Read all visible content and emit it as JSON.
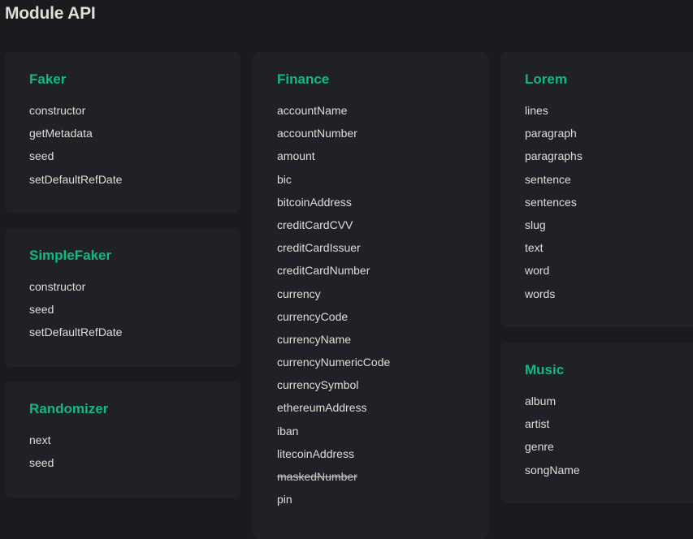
{
  "page": {
    "title": "Module API"
  },
  "cards": {
    "faker": {
      "title": "Faker",
      "items": [
        "constructor",
        "getMetadata",
        "seed",
        "setDefaultRefDate"
      ]
    },
    "simplefaker": {
      "title": "SimpleFaker",
      "items": [
        "constructor",
        "seed",
        "setDefaultRefDate"
      ]
    },
    "randomizer": {
      "title": "Randomizer",
      "items": [
        "next",
        "seed"
      ]
    },
    "finance": {
      "title": "Finance",
      "items": [
        "accountName",
        "accountNumber",
        "amount",
        "bic",
        "bitcoinAddress",
        "creditCardCVV",
        "creditCardIssuer",
        "creditCardNumber",
        "currency",
        "currencyCode",
        "currencyName",
        "currencyNumericCode",
        "currencySymbol",
        "ethereumAddress",
        "iban",
        "litecoinAddress",
        "maskedNumber",
        "pin"
      ],
      "deprecated": [
        "maskedNumber"
      ]
    },
    "lorem": {
      "title": "Lorem",
      "items": [
        "lines",
        "paragraph",
        "paragraphs",
        "sentence",
        "sentences",
        "slug",
        "text",
        "word",
        "words"
      ]
    },
    "music": {
      "title": "Music",
      "items": [
        "album",
        "artist",
        "genre",
        "songName"
      ]
    }
  },
  "colors": {
    "background": "#1b1b1f",
    "card": "#202127",
    "accent": "#10b981",
    "text": "#dfdfd6"
  }
}
